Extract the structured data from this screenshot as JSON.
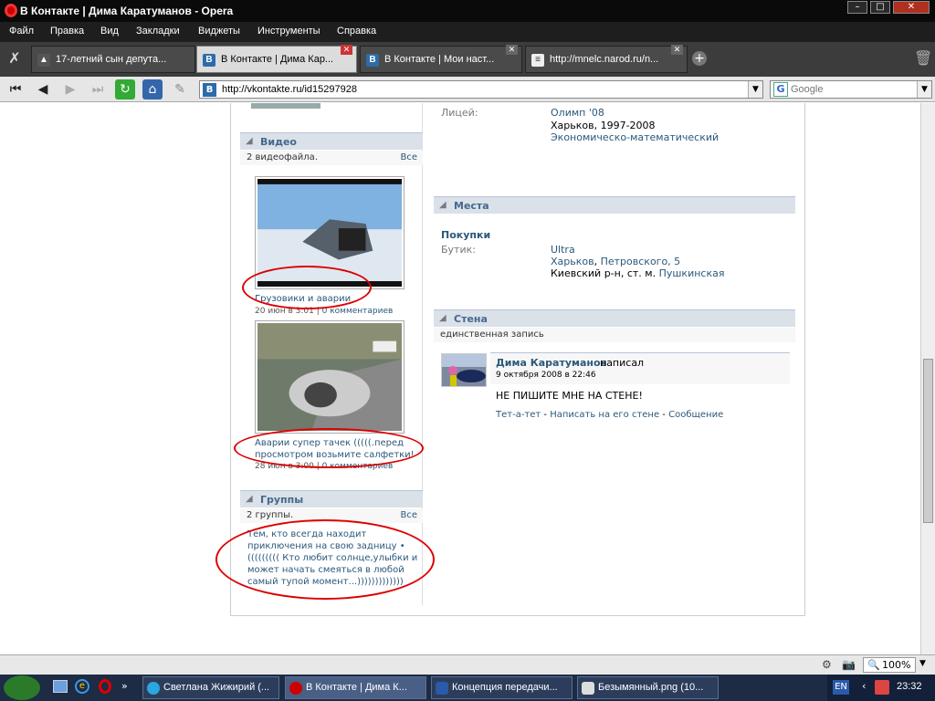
{
  "window": {
    "title": "В Контакте | Дима Каратуманов - Opera"
  },
  "menu": [
    "Файл",
    "Правка",
    "Вид",
    "Закладки",
    "Виджеты",
    "Инструменты",
    "Справка"
  ],
  "tabs": [
    {
      "label": "17-летний сын депута..."
    },
    {
      "label": "В Контакте | Дима Кар..."
    },
    {
      "label": "В Контакте | Мои наст..."
    },
    {
      "label": "http://mnelc.narod.ru/n..."
    }
  ],
  "address": {
    "url": "http://vkontakte.ru/id15297928"
  },
  "search": {
    "placeholder": "Google"
  },
  "video": {
    "title": "Видео",
    "count": "2 видеофайла.",
    "all": "Все",
    "items": [
      {
        "title": "Грузовики и аварии",
        "date": "20 июн в 3:01",
        "comments": "0 комментариев"
      },
      {
        "title": "Аварии супер тачек (((((.перед просмотром возьмите салфетки!",
        "date": "28 июн в 3:00",
        "comments": "0 комментариев"
      }
    ]
  },
  "groups": {
    "title": "Группы",
    "count": "2 группы.",
    "all": "Все",
    "list_text": "Тем, кто всегда находит приключения на свою задницу • ((((((((( Кто любит солнце,улыбки и может начать смеяться в любой самый тупой момент...)))))))))))))"
  },
  "education": {
    "label": "Лицей:",
    "school": "Олимп '08",
    "place": "Харьков, 1997-2008",
    "faculty": "Экономическо-математический"
  },
  "places": {
    "title": "Места",
    "category": "Покупки",
    "label": "Бутик:",
    "name": "Ultra",
    "city": "Харьков",
    "street": "Петровского, 5",
    "district": "Киевский р-н, ст. м.",
    "metro": "Пушкинская"
  },
  "wall": {
    "title": "Стена",
    "sub": "единственная запись",
    "author": "Дима Каратуманов",
    "wrote": "написал",
    "date": "9 октября 2008 в 22:46",
    "text": "НЕ ПИШИТЕ МНЕ НА СТЕНЕ!",
    "actions": [
      "Тет-а-тет",
      "Написать на его стене",
      "Сообщение"
    ]
  },
  "status": {
    "zoom": "100%"
  },
  "taskbar": [
    {
      "label": "Светлана Жижирий (..."
    },
    {
      "label": "В Контакте | Дима К..."
    },
    {
      "label": "Концепция передачи..."
    },
    {
      "label": "Безымянный.png (10..."
    }
  ],
  "tray": {
    "lang": "EN",
    "time": "23:32"
  },
  "colors": {
    "vk_link": "#2b587a",
    "vk_header": "#dae1e8",
    "highlight_ellipse": "#dd0000"
  }
}
